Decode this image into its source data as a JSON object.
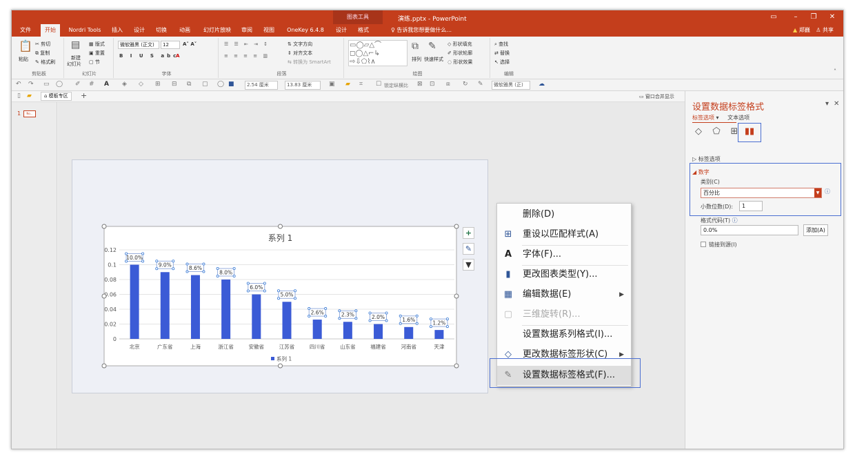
{
  "window": {
    "title": "演练.pptx - PowerPoint",
    "context_tools": "图表工具"
  },
  "tabs": [
    {
      "label": "文件"
    },
    {
      "label": "开始"
    },
    {
      "label": "Nordri Tools"
    },
    {
      "label": "插入"
    },
    {
      "label": "设计"
    },
    {
      "label": "切换"
    },
    {
      "label": "动画"
    },
    {
      "label": "幻灯片放映"
    },
    {
      "label": "审阅"
    },
    {
      "label": "视图"
    },
    {
      "label": "OneKey 6.4.8"
    },
    {
      "label": "设计"
    },
    {
      "label": "格式"
    }
  ],
  "tell_me": "告诉我您想要做什么...",
  "user": {
    "name": "郑巍",
    "share": "共享"
  },
  "ribbon": {
    "clipboard": {
      "paste": "粘贴",
      "cut": "剪切",
      "copy": "复制",
      "format_painter": "格式刷",
      "label": "剪贴板"
    },
    "slides": {
      "new_slide": "新建",
      "new_slide2": "幻灯片",
      "layout": "版式",
      "reset": "重置",
      "section": "节",
      "label": "幻灯片"
    },
    "font": {
      "font_name": "微软雅黑 (正文)",
      "font_size": "12",
      "label": "字体"
    },
    "paragraph": {
      "text_direction": "文字方向",
      "align_text": "对齐文本",
      "smartart": "转换为 SmartArt",
      "label": "段落"
    },
    "drawing": {
      "arrange": "排列",
      "quick_styles": "快速样式",
      "shape_fill": "形状填充",
      "shape_outline": "形状轮廓",
      "shape_effects": "形状效果",
      "label": "绘图"
    },
    "editing": {
      "find": "查找",
      "replace": "替换",
      "select": "选择",
      "label": "编辑"
    }
  },
  "qat": {
    "width_value": "2.54 厘米",
    "height_value": "13.83 厘米",
    "lock_aspect": "锁定纵横比",
    "font_box": "微软雅黑 (正)"
  },
  "doctabs": {
    "template_area": "模板专区",
    "merge_window": "窗口合并显示"
  },
  "slide_panel": {
    "number": "1",
    "thumb_text": "No..."
  },
  "chart_data": {
    "type": "bar",
    "title": "系列 1",
    "categories": [
      "北京",
      "广东省",
      "上海",
      "浙江省",
      "安徽省",
      "江苏省",
      "四川省",
      "山东省",
      "福建省",
      "河南省",
      "天津"
    ],
    "series": [
      {
        "name": "系列 1",
        "values": [
          0.1,
          0.09,
          0.086,
          0.08,
          0.06,
          0.05,
          0.026,
          0.023,
          0.02,
          0.016,
          0.012
        ]
      }
    ],
    "data_labels": [
      "10.0%",
      "9.0%",
      "8.6%",
      "8.0%",
      "6.0%",
      "5.0%",
      "2.6%",
      "2.3%",
      "2.0%",
      "1.6%",
      "1.2%"
    ],
    "y_ticks": [
      "0",
      "0.02",
      "0.04",
      "0.06",
      "0.08",
      "0.1",
      "0.12"
    ],
    "ylim": [
      0,
      0.12
    ],
    "bar_color": "#3b5bd6",
    "legend_placement": "bottom",
    "grid": true
  },
  "context_menu": {
    "items": [
      {
        "label": "删除(D)",
        "icon": "none",
        "disabled": false
      },
      {
        "label": "重设以匹配样式(A)",
        "icon": "reset-style-icon",
        "disabled": false
      },
      {
        "label": "字体(F)...",
        "icon": "font-A-icon",
        "disabled": false
      },
      {
        "label": "更改图表类型(Y)...",
        "icon": "chart-type-icon",
        "disabled": false
      },
      {
        "label": "编辑数据(E)",
        "icon": "edit-data-icon",
        "disabled": false,
        "submenu": true
      },
      {
        "label": "三维旋转(R)...",
        "icon": "3d-rotation-icon",
        "disabled": true
      },
      {
        "label": "设置数据系列格式(I)...",
        "icon": "none",
        "disabled": false
      },
      {
        "label": "更改数据标签形状(C)",
        "icon": "label-shape-icon",
        "disabled": false,
        "submenu": true
      },
      {
        "label": "设置数据标签格式(F)...",
        "icon": "format-label-icon",
        "disabled": false,
        "highlighted": true
      }
    ]
  },
  "pane": {
    "title": "设置数据标签格式",
    "tab_label_options": "标签选项",
    "tab_text_options": "文本选项",
    "section_label_options": "标签选项",
    "section_number": "数字",
    "category_label": "类别(C)",
    "category_value": "百分比",
    "decimal_label": "小数位数(D):",
    "decimal_value": "1",
    "format_code_label": "格式代码(T)",
    "format_code_value": "0.0%",
    "add_button": "添加(A)",
    "link_source": "链接到源(I)",
    "accent": "#c43e1c"
  }
}
